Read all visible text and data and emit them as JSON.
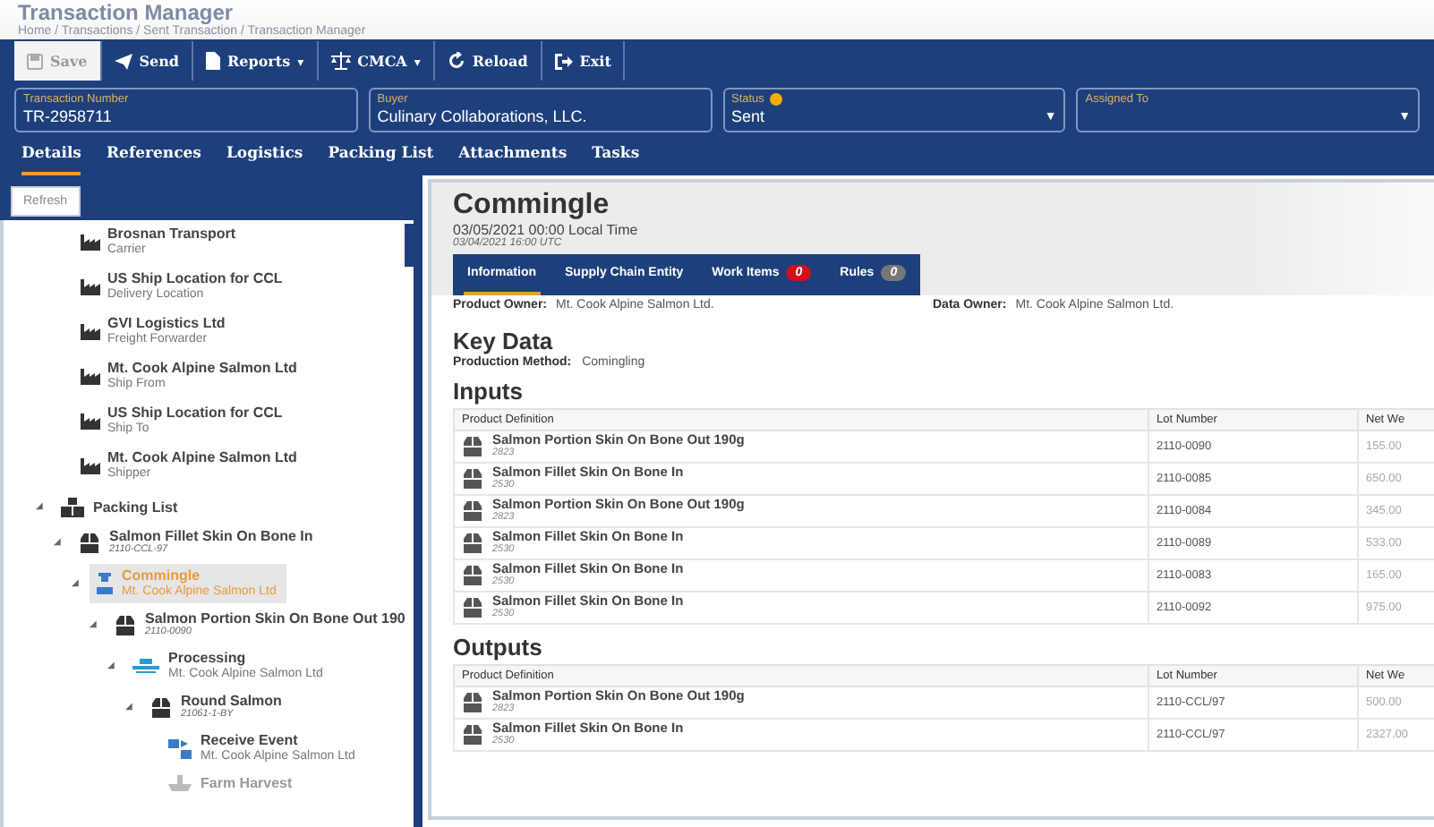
{
  "header": {
    "title": "Transaction Manager",
    "breadcrumb": "Home / Transactions / Sent Transaction / Transaction Manager"
  },
  "toolbar": [
    {
      "label": "Save",
      "kind": "save",
      "disabled": true
    },
    {
      "label": "Send",
      "kind": "send",
      "disabled": false
    },
    {
      "label": "Reports",
      "kind": "reports",
      "disabled": false,
      "caret": "▾"
    },
    {
      "label": "CMCA",
      "kind": "cmca",
      "disabled": false,
      "caret": "▾"
    },
    {
      "label": "Reload",
      "kind": "reload",
      "disabled": false
    },
    {
      "label": "Exit",
      "kind": "exit",
      "disabled": false
    }
  ],
  "fields": [
    {
      "label": "Transaction Number",
      "value": "TR-2958711",
      "kind": "text"
    },
    {
      "label": "Buyer",
      "value": "Culinary Collaborations, LLC.",
      "kind": "text"
    },
    {
      "label": "Status",
      "value": "Sent",
      "kind": "select",
      "help": true,
      "arrow": "▼"
    },
    {
      "label": "Assigned To",
      "kind": "select",
      "arrow": "▼"
    }
  ],
  "tabs": [
    {
      "label": "Details",
      "selected": true
    },
    {
      "label": "References",
      "selected": false
    },
    {
      "label": "Logistics",
      "selected": false
    },
    {
      "label": "Packing List",
      "selected": false
    },
    {
      "label": "Attachments",
      "selected": false
    },
    {
      "label": "Tasks",
      "selected": false
    }
  ],
  "sidebar": {
    "refresh": "Refresh",
    "parties": [
      {
        "name": "Brosnan Transport",
        "role": "Carrier"
      },
      {
        "name": "US Ship Location for CCL",
        "role": "Delivery Location"
      },
      {
        "name": "GVI Logistics Ltd",
        "role": "Freight Forwarder"
      },
      {
        "name": "Mt. Cook Alpine Salmon Ltd",
        "role": "Ship From"
      },
      {
        "name": "US Ship Location for CCL",
        "role": "Ship To"
      },
      {
        "name": "Mt. Cook Alpine Salmon Ltd",
        "role": "Shipper"
      }
    ],
    "tree": [
      {
        "kind": "group",
        "name": "Packing List",
        "toggle": "◢",
        "expanded": true,
        "selected": false,
        "children": [
          {
            "kind": "product",
            "name": "Salmon Fillet Skin On Bone In",
            "sub": "2110-CCL-97",
            "toggle": "◢",
            "expanded": true,
            "selected": false,
            "children": [
              {
                "kind": "commingle",
                "name": "Commingle",
                "sub": "Mt. Cook Alpine Salmon Ltd",
                "toggle": "◢",
                "expanded": true,
                "selected": true,
                "children": [
                  {
                    "kind": "product",
                    "name": "Salmon Portion Skin On Bone Out 190",
                    "sub": "2110-0090",
                    "toggle": "◢",
                    "expanded": true,
                    "selected": false,
                    "children": [
                      {
                        "kind": "processing",
                        "name": "Processing",
                        "sub": "Mt. Cook Alpine Salmon Ltd",
                        "toggle": "◢",
                        "expanded": true,
                        "selected": false,
                        "children": [
                          {
                            "kind": "product",
                            "name": "Round Salmon",
                            "sub": "21061-1-BY",
                            "toggle": "◢",
                            "expanded": true,
                            "selected": false,
                            "children": [
                              {
                                "kind": "receive",
                                "name": "Receive Event",
                                "sub": "Mt. Cook Alpine Salmon Ltd",
                                "selected": false
                              },
                              {
                                "kind": "harvest",
                                "name": "Farm Harvest",
                                "selected": false
                              }
                            ]
                          }
                        ]
                      }
                    ]
                  }
                ]
              }
            ]
          }
        ]
      }
    ]
  },
  "detail": {
    "title": "Commingle",
    "local_time": "03/05/2021 00:00 Local Time",
    "utc_time": "03/04/2021 16:00 UTC",
    "tabs": [
      {
        "label": "Information",
        "selected": true
      },
      {
        "label": "Supply Chain Entity",
        "selected": false
      },
      {
        "label": "Work Items",
        "selected": false,
        "badge": "0",
        "color": "#d0101a"
      },
      {
        "label": "Rules",
        "selected": false,
        "badge": "0",
        "color": "#777777"
      }
    ],
    "owners": [
      {
        "label": "Product Owner:",
        "value": "Mt. Cook Alpine Salmon Ltd."
      },
      {
        "label": "Data Owner:",
        "value": "Mt. Cook Alpine Salmon Ltd."
      }
    ],
    "key_data": {
      "heading": "Key Data",
      "label": "Production Method:",
      "value": "Comingling"
    },
    "sections": [
      {
        "heading": "Inputs",
        "columns": [
          "Product Definition",
          "Lot Number",
          "Net We"
        ],
        "rows": [
          {
            "product": "Salmon Portion Skin On Bone Out 190g",
            "code": "2823",
            "lot": "2110-0090",
            "net": "155.00"
          },
          {
            "product": "Salmon Fillet Skin On Bone In",
            "code": "2530",
            "lot": "2110-0085",
            "net": "650.00"
          },
          {
            "product": "Salmon Portion Skin On Bone Out 190g",
            "code": "2823",
            "lot": "2110-0084",
            "net": "345.00"
          },
          {
            "product": "Salmon Fillet Skin On Bone In",
            "code": "2530",
            "lot": "2110-0089",
            "net": "533.00"
          },
          {
            "product": "Salmon Fillet Skin On Bone In",
            "code": "2530",
            "lot": "2110-0083",
            "net": "165.00"
          },
          {
            "product": "Salmon Fillet Skin On Bone In",
            "code": "2530",
            "lot": "2110-0092",
            "net": "975.00"
          }
        ]
      },
      {
        "heading": "Outputs",
        "columns": [
          "Product Definition",
          "Lot Number",
          "Net We"
        ],
        "rows": [
          {
            "product": "Salmon Portion Skin On Bone Out 190g",
            "code": "2823",
            "lot": "2110-CCL/97",
            "net": "500.00"
          },
          {
            "product": "Salmon Fillet Skin On Bone In",
            "code": "2530",
            "lot": "2110-CCL/97",
            "net": "2327.00"
          }
        ]
      }
    ]
  }
}
